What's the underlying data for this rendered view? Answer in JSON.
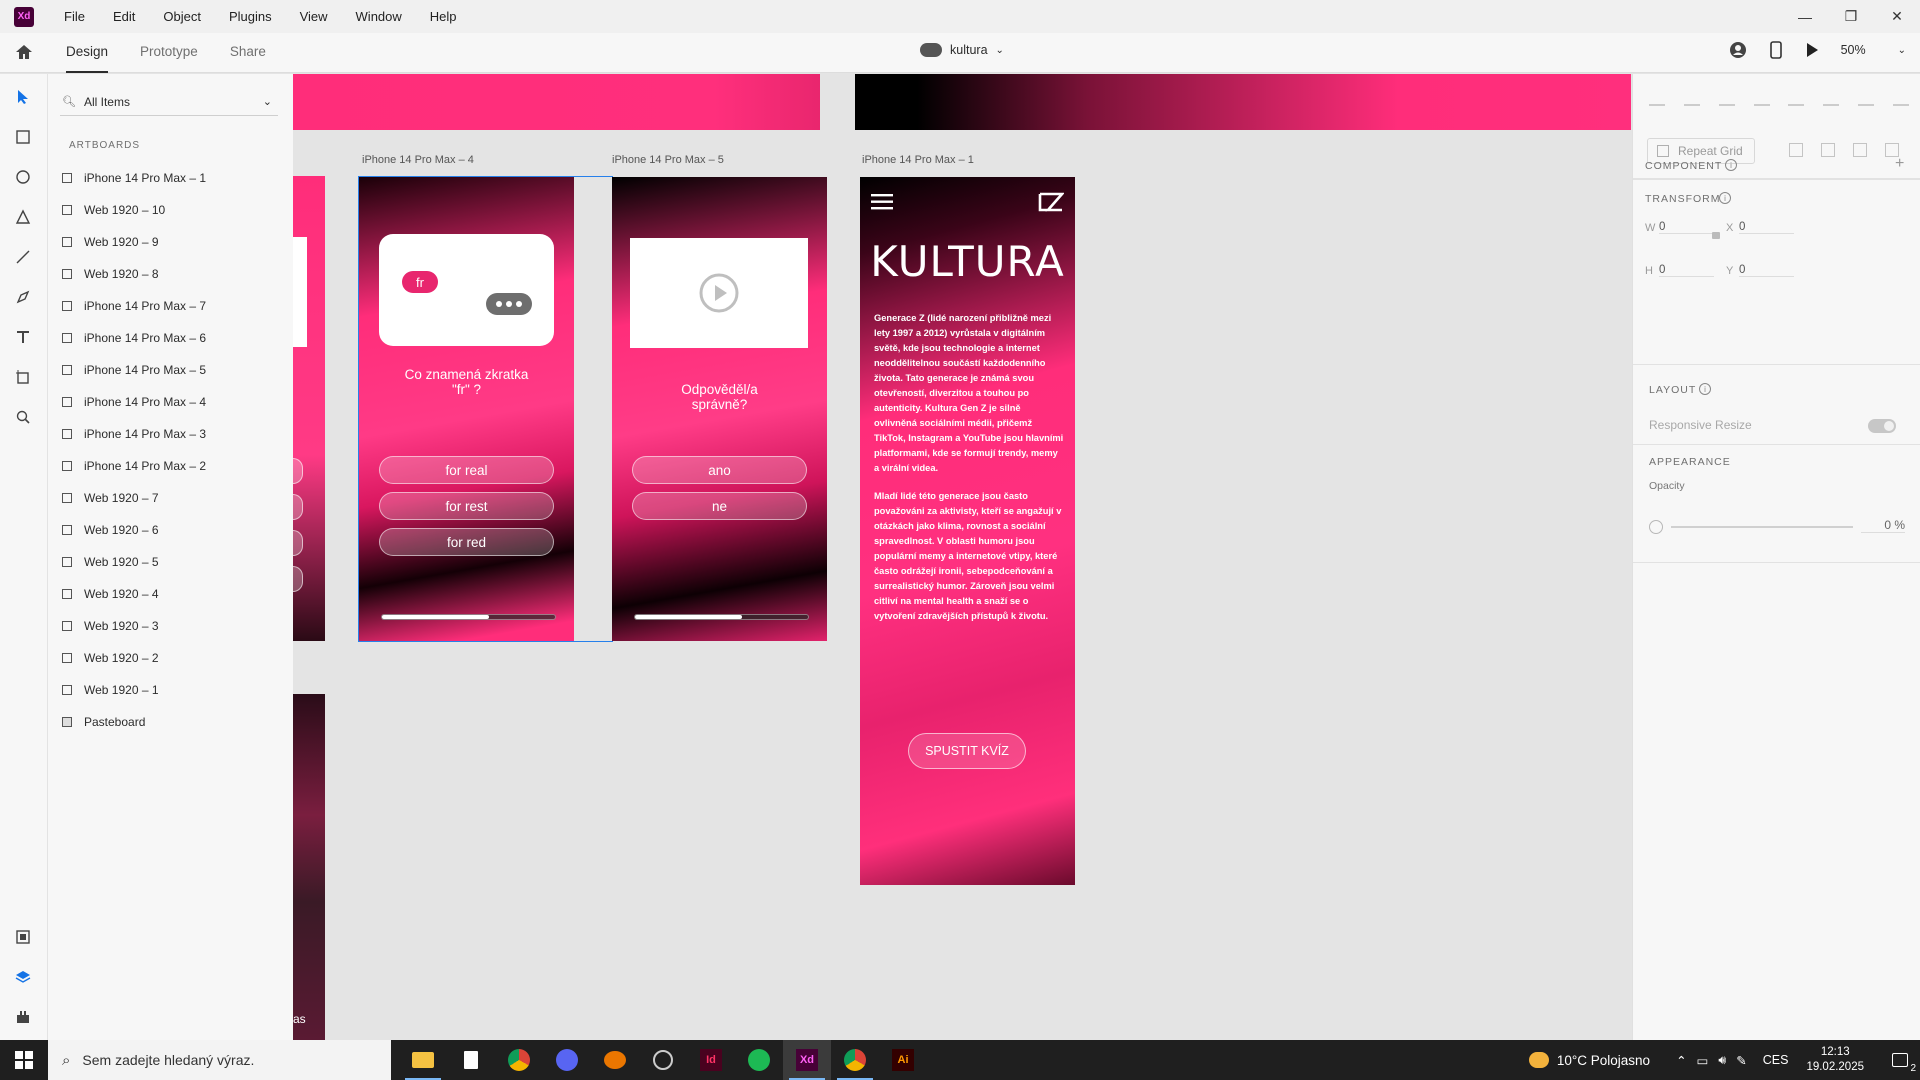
{
  "menubar": {
    "logo": "Xd",
    "items": [
      "File",
      "Edit",
      "Object",
      "Plugins",
      "View",
      "Window",
      "Help"
    ]
  },
  "toolbar": {
    "tabs": [
      "Design",
      "Prototype",
      "Share"
    ],
    "doc_name": "kultura",
    "zoom": "50%"
  },
  "layers": {
    "search_placeholder": "All Items",
    "section": "ARTBOARDS",
    "items": [
      "iPhone 14 Pro Max – 1",
      "Web 1920 – 10",
      "Web 1920 – 9",
      "Web 1920 – 8",
      "iPhone 14 Pro Max – 7",
      "iPhone 14 Pro Max – 6",
      "iPhone 14 Pro Max – 5",
      "iPhone 14 Pro Max – 4",
      "iPhone 14 Pro Max – 3",
      "iPhone 14 Pro Max – 2",
      "Web 1920 – 7",
      "Web 1920 – 6",
      "Web 1920 – 5",
      "Web 1920 – 4",
      "Web 1920 – 3",
      "Web 1920 – 2",
      "Web 1920 – 1",
      "Pasteboard"
    ]
  },
  "canvas": {
    "ab4": {
      "label": "iPhone 14 Pro Max – 4",
      "badge": "fr",
      "question": "Co znamená zkratka \"fr\" ?",
      "options": [
        "for real",
        "for rest",
        "for red"
      ],
      "progress": 0.62
    },
    "ab5": {
      "label": "iPhone 14 Pro Max – 5",
      "question": "Odpověděl/a správně?",
      "options": [
        "ano",
        "ne"
      ],
      "progress": 0.62
    },
    "ab1": {
      "label": "iPhone 14 Pro Max – 1",
      "title": "KULTURA",
      "para1": "Generace Z (lidé narození přibližně mezi lety 1997 a 2012) vyrůstala v digitálním světě, kde jsou technologie a internet neoddělitelnou součástí každodenního života. Tato generace je známá svou otevřeností, diverzitou a touhou po autenticity. Kultura Gen Z je silně ovlivněná sociálními médii, přičemž TikTok, Instagram a YouTube jsou hlavními platformami, kde se formují trendy, memy a virální videa.",
      "para2": "Mladí lidé této generace jsou často považováni za aktivisty, kteří se angažují v otázkách jako klima, rovnost a sociální spravedlnost. V oblasti humoru jsou populární memy a internetové vtipy, které často odrážejí ironii, sebepodceňování a surrealistický humor. Zároveň jsou velmi citliví na mental health a snaží se o vytvoření zdravějších přístupů k životu.",
      "button": "SPUSTIT KVÍZ"
    },
    "left_fragment_text": "as"
  },
  "props": {
    "repeat_grid": "Repeat Grid",
    "component": "COMPONENT",
    "transform": "TRANSFORM",
    "w_label": "W",
    "w_value": "0",
    "x_label": "X",
    "x_value": "0",
    "h_label": "H",
    "h_value": "0",
    "y_label": "Y",
    "y_value": "0",
    "layout": "LAYOUT",
    "responsive_resize": "Responsive Resize",
    "appearance": "APPEARANCE",
    "opacity_label": "Opacity",
    "opacity_value": "0 %"
  },
  "taskbar": {
    "search_placeholder": "Sem zadejte hledaný výraz.",
    "weather": "10°C  Polojasno",
    "lang": "CES",
    "time": "12:13",
    "date": "19.02.2025",
    "notifications": "2"
  },
  "colors": {
    "accent_pink": "#ff2d7a",
    "selection_blue": "#2680eb"
  }
}
